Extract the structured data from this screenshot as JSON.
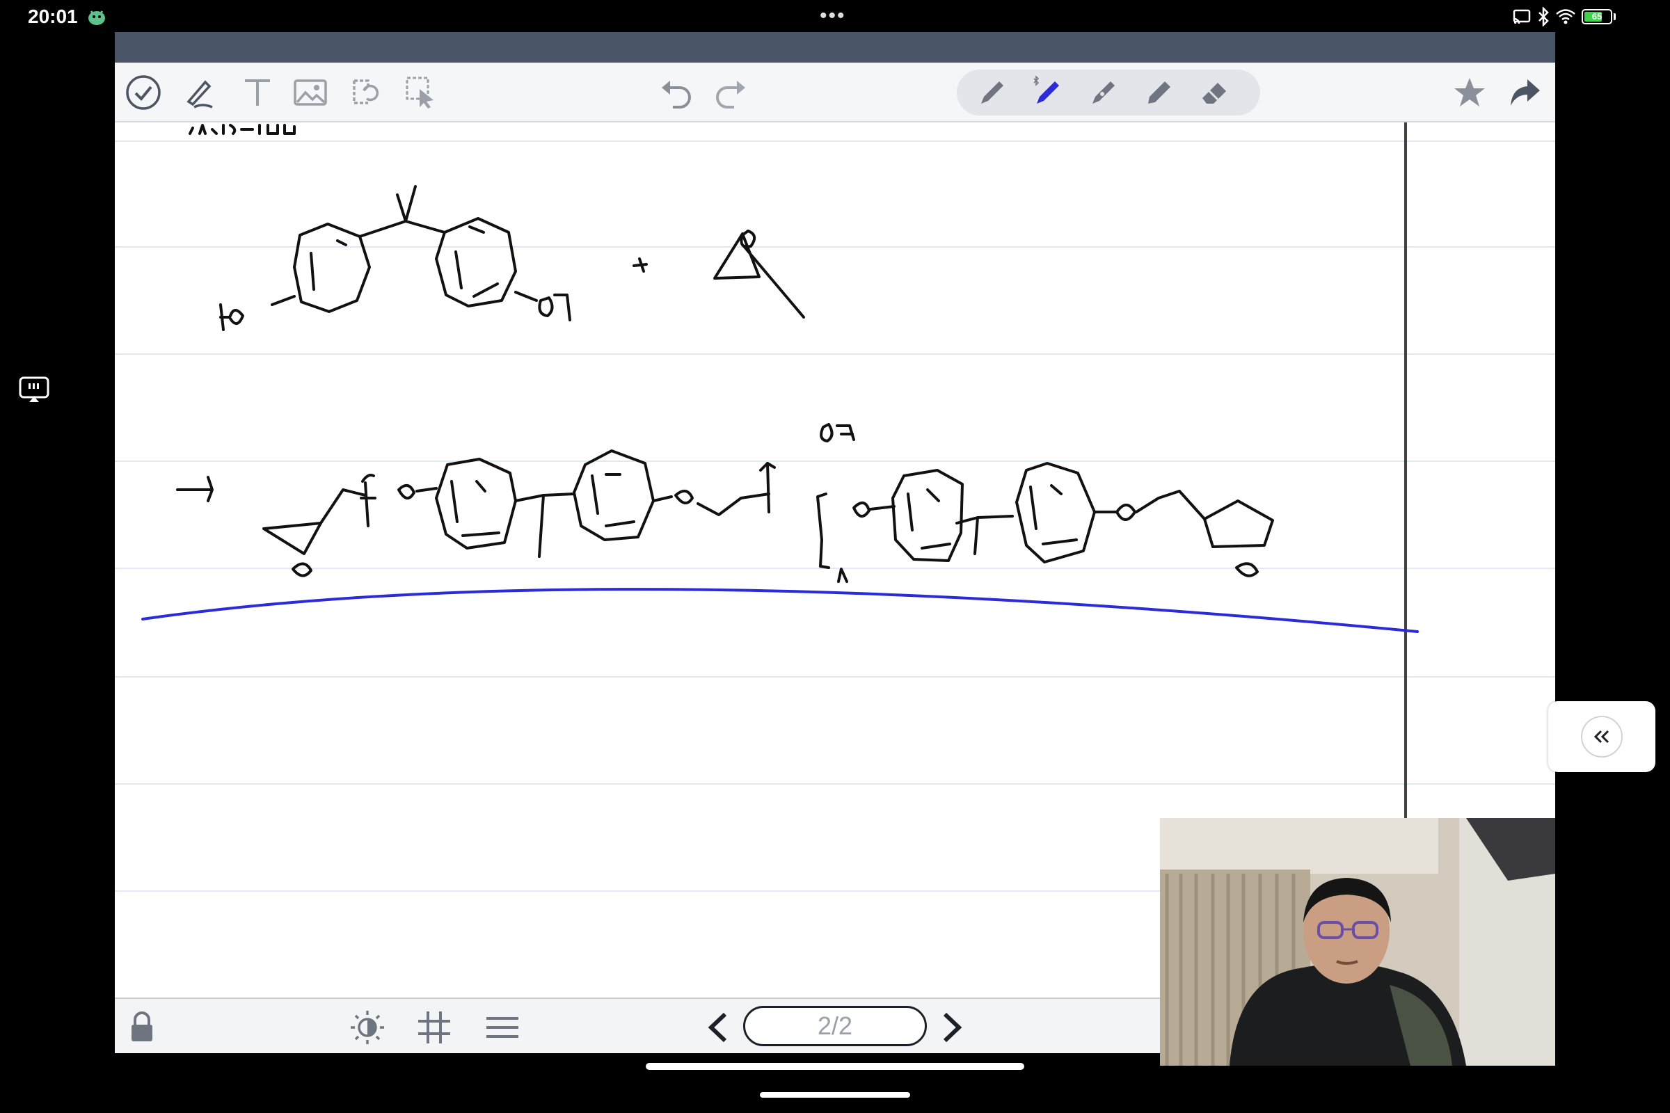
{
  "status_bar": {
    "time": "20:01",
    "dots": "•••",
    "battery_level": "65",
    "icons": [
      "screen-cast-icon",
      "bluetooth-icon",
      "wifi-icon",
      "battery-icon"
    ]
  },
  "toolbar": {
    "left_tools": [
      "checkmark-done-icon",
      "pen-tool-icon",
      "text-tool-icon",
      "image-tool-icon",
      "lasso-tool-icon",
      "select-tool-icon"
    ],
    "history": [
      "undo-icon",
      "redo-icon"
    ],
    "pens": [
      "pen-1-icon",
      "bluetooth-pen-icon",
      "pen-3-icon",
      "highlighter-icon",
      "eraser-icon"
    ],
    "active_pen_color": "#2b2bd9",
    "right_tools": [
      "star-icon",
      "share-icon"
    ]
  },
  "bottom_bar": {
    "page_indicator": "2/2",
    "tools": [
      "lock-icon",
      "brightness-icon",
      "grid-icon",
      "lines-icon"
    ]
  },
  "colors": {
    "toolbar_bg": "#f5f6f8",
    "ink": "#111111",
    "blue_ink": "#2b2bd9",
    "ruled_line": "#dfe8f3"
  }
}
